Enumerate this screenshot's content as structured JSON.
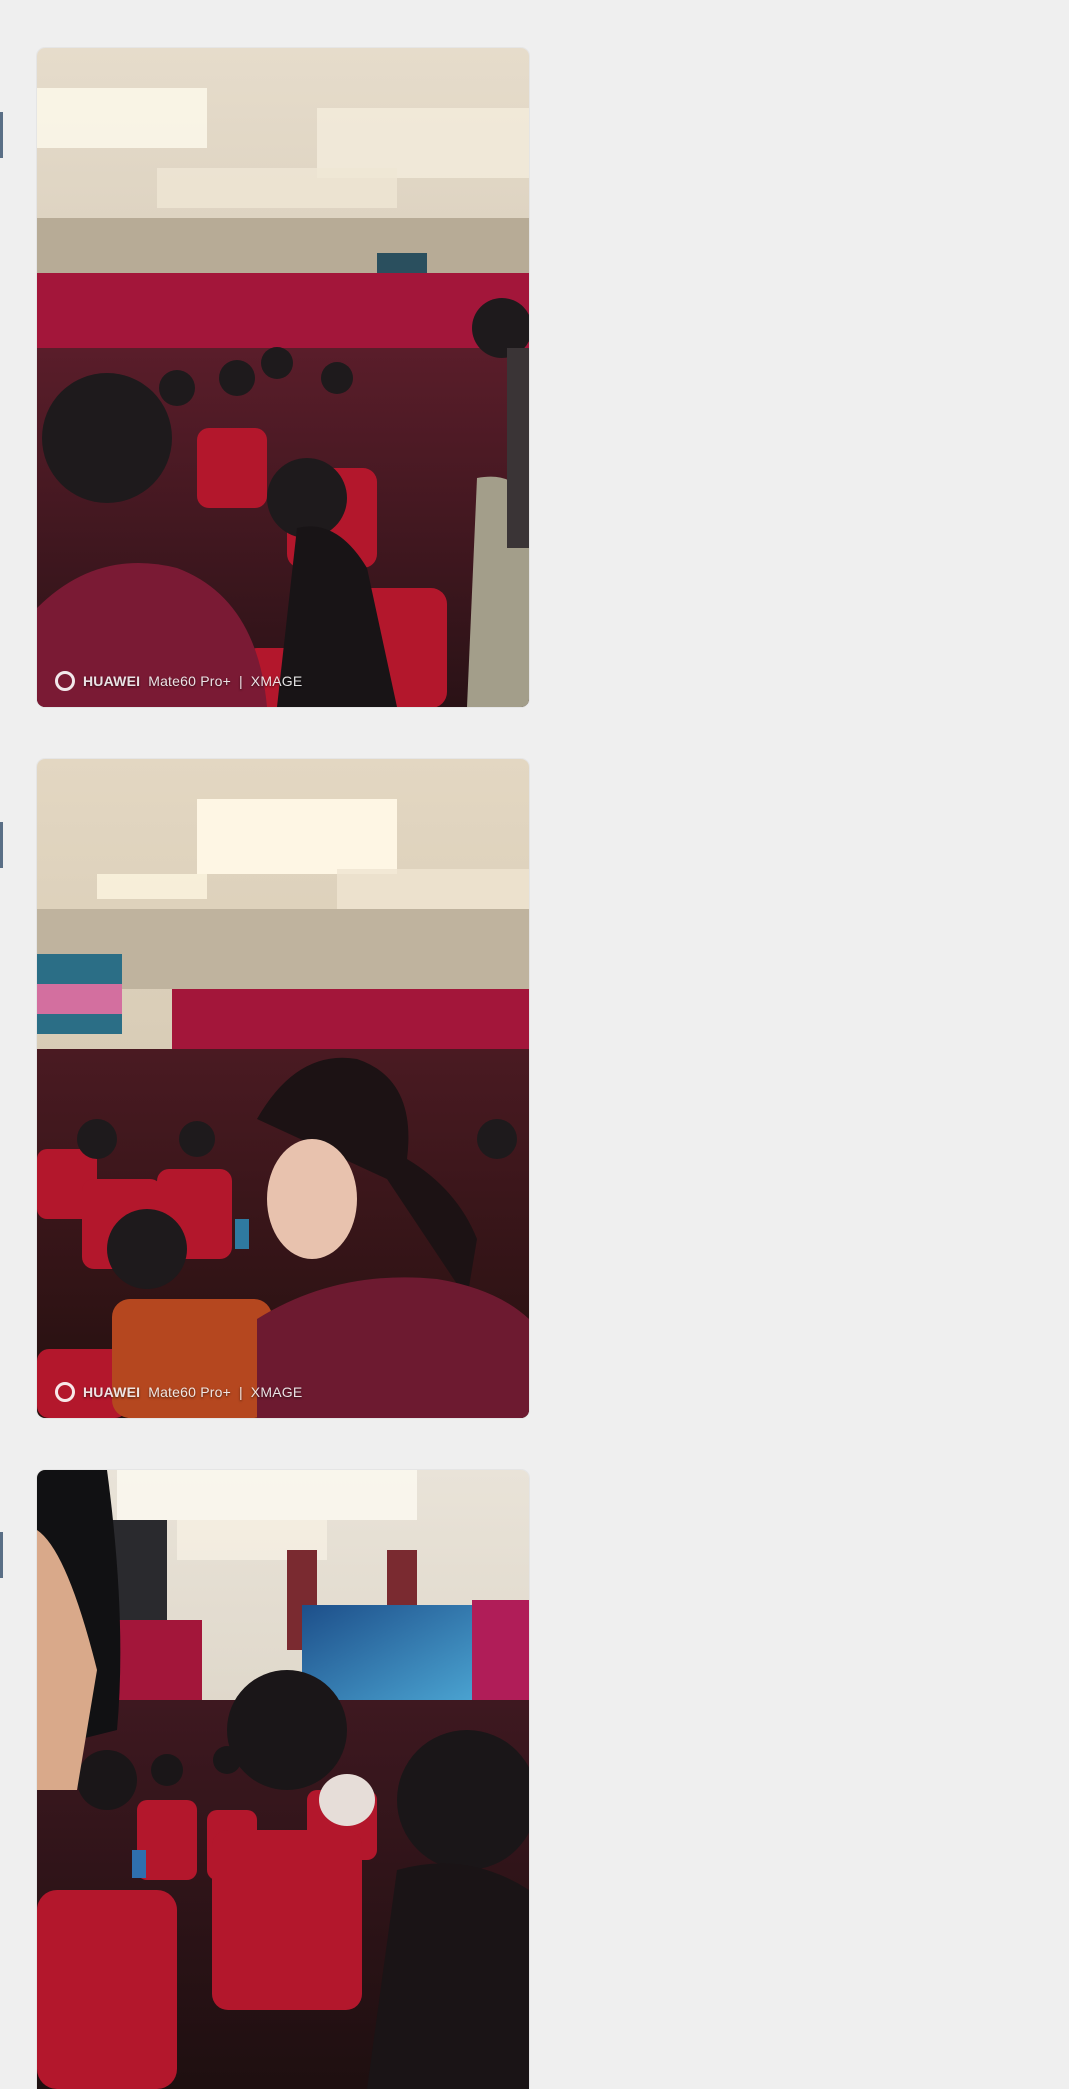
{
  "gallery": {
    "photos": [
      {
        "watermark": {
          "brand": "HUAWEI",
          "model": "Mate60 Pro+",
          "lens": "XMAGE"
        }
      },
      {
        "watermark": {
          "brand": "HUAWEI",
          "model": "Mate60 Pro+",
          "lens": "XMAGE"
        }
      },
      {
        "watermark": null
      }
    ]
  },
  "colors": {
    "page_bg": "#efefef",
    "banner_red": "#a3163a",
    "seat_red": "#b3172c",
    "ceiling": "#dcd3c4"
  }
}
